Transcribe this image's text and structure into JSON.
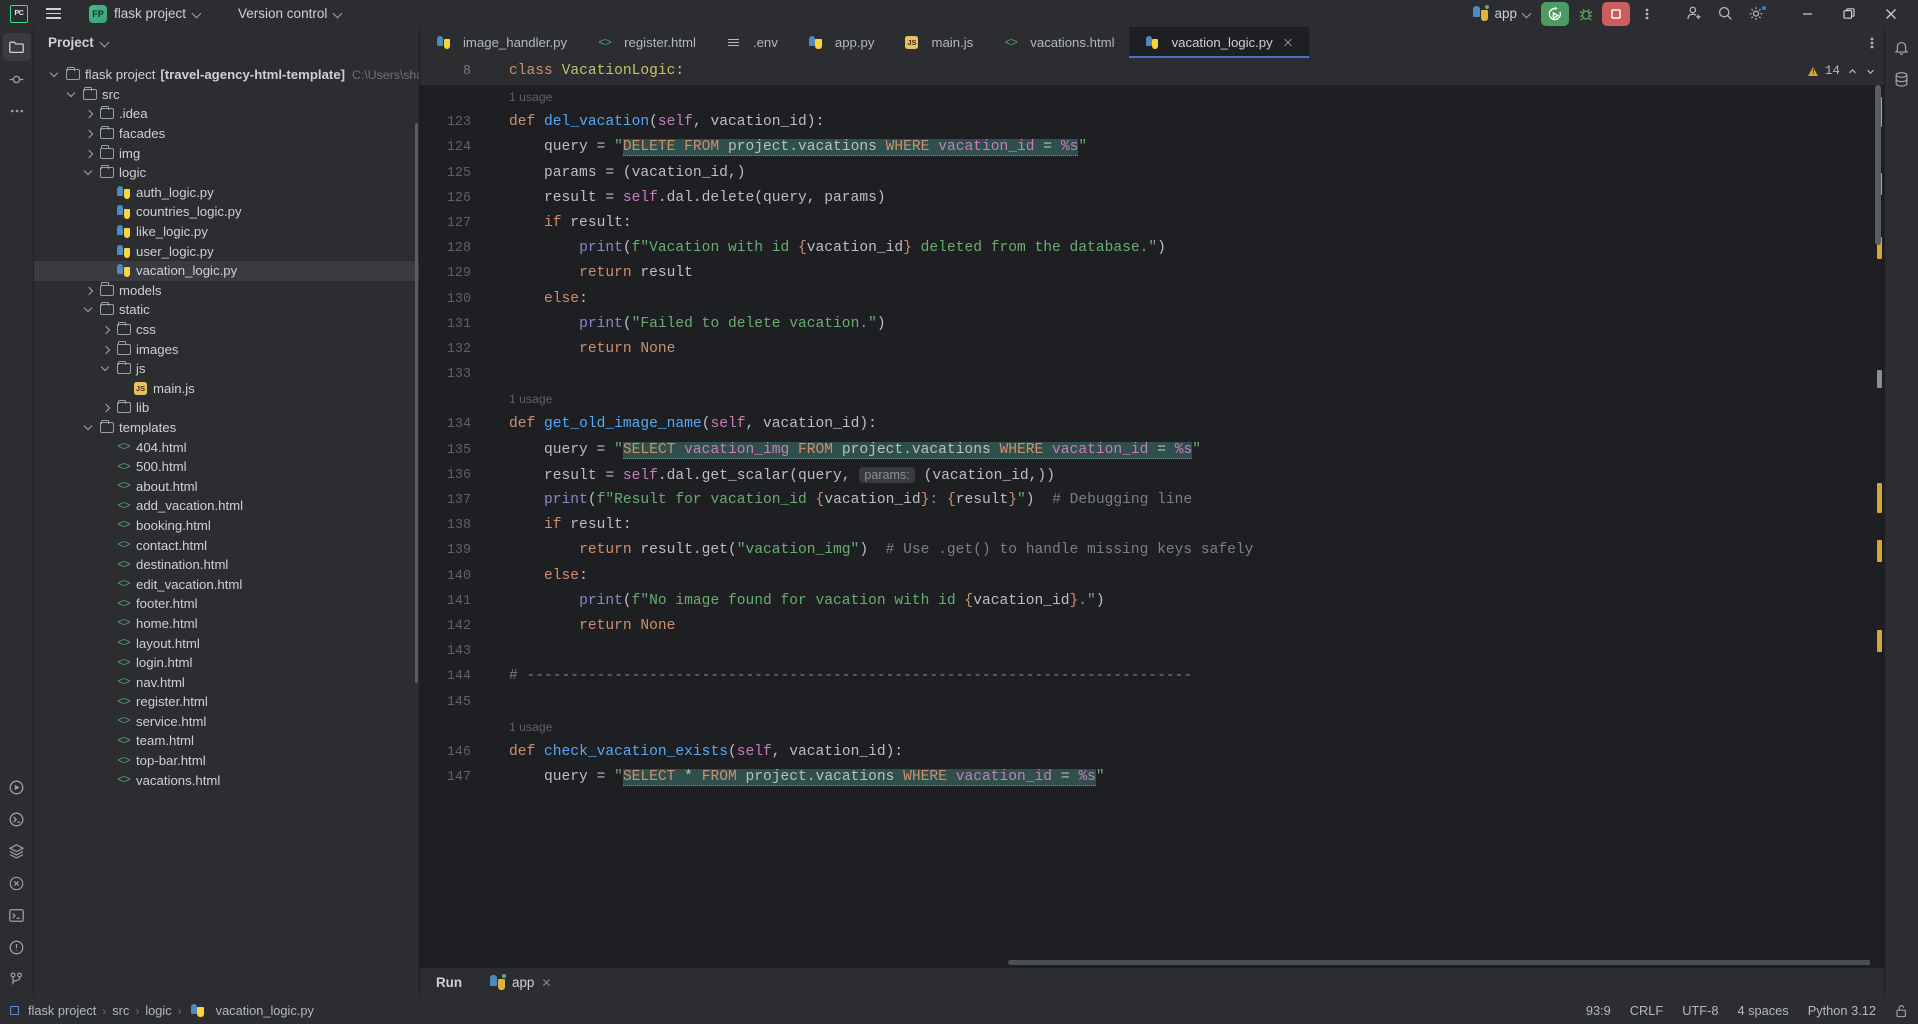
{
  "titlebar": {
    "logo": "PC",
    "menu_icon": "hamburger-icon",
    "project_badge": "FP",
    "project_name": "flask project",
    "version_control": "Version control",
    "run_config": "app",
    "icons": [
      "python-icon",
      "run-icon",
      "debug-icon",
      "stop-icon",
      "more-vertical-icon",
      "add-user-icon",
      "search-icon",
      "settings-gear-icon",
      "minimize-icon",
      "maximize-icon",
      "close-icon"
    ]
  },
  "rail": {
    "top": [
      "project-folder-icon",
      "commit-icon",
      "more-tools-icon"
    ],
    "bottom": [
      "run-icon",
      "python-console-icon",
      "services-icon",
      "debug-icon",
      "terminal-icon",
      "problems-icon",
      "branch-icon"
    ]
  },
  "right_rail": [
    "notifications-bell-icon",
    "database-icon"
  ],
  "project_panel": {
    "title": "Project",
    "tree": [
      {
        "depth": 0,
        "arrow": "down",
        "icon": "folder",
        "label": "flask project",
        "bold_suffix": "[travel-agency-html-template]",
        "path": "C:\\Users\\shani\\Deskto",
        "selected": false
      },
      {
        "depth": 1,
        "arrow": "down",
        "icon": "folder",
        "label": "src",
        "selected": false
      },
      {
        "depth": 2,
        "arrow": "right",
        "icon": "folder",
        "label": ".idea",
        "selected": false
      },
      {
        "depth": 2,
        "arrow": "right",
        "icon": "folder",
        "label": "facades",
        "selected": false
      },
      {
        "depth": 2,
        "arrow": "right",
        "icon": "folder",
        "label": "img",
        "selected": false
      },
      {
        "depth": 2,
        "arrow": "down",
        "icon": "folder",
        "label": "logic",
        "selected": false
      },
      {
        "depth": 3,
        "arrow": "none",
        "icon": "python",
        "label": "auth_logic.py",
        "selected": false
      },
      {
        "depth": 3,
        "arrow": "none",
        "icon": "python",
        "label": "countries_logic.py",
        "selected": false
      },
      {
        "depth": 3,
        "arrow": "none",
        "icon": "python",
        "label": "like_logic.py",
        "selected": false
      },
      {
        "depth": 3,
        "arrow": "none",
        "icon": "python",
        "label": "user_logic.py",
        "selected": false
      },
      {
        "depth": 3,
        "arrow": "none",
        "icon": "python",
        "label": "vacation_logic.py",
        "selected": true
      },
      {
        "depth": 2,
        "arrow": "right",
        "icon": "folder",
        "label": "models",
        "selected": false
      },
      {
        "depth": 2,
        "arrow": "down",
        "icon": "folder",
        "label": "static",
        "selected": false
      },
      {
        "depth": 3,
        "arrow": "right",
        "icon": "folder",
        "label": "css",
        "selected": false
      },
      {
        "depth": 3,
        "arrow": "right",
        "icon": "folder",
        "label": "images",
        "selected": false
      },
      {
        "depth": 3,
        "arrow": "down",
        "icon": "folder",
        "label": "js",
        "selected": false
      },
      {
        "depth": 4,
        "arrow": "none",
        "icon": "js",
        "label": "main.js",
        "selected": false
      },
      {
        "depth": 3,
        "arrow": "right",
        "icon": "folder",
        "label": "lib",
        "selected": false
      },
      {
        "depth": 2,
        "arrow": "down",
        "icon": "folder",
        "label": "templates",
        "selected": false
      },
      {
        "depth": 3,
        "arrow": "none",
        "icon": "html",
        "label": "404.html",
        "selected": false
      },
      {
        "depth": 3,
        "arrow": "none",
        "icon": "html",
        "label": "500.html",
        "selected": false
      },
      {
        "depth": 3,
        "arrow": "none",
        "icon": "html",
        "label": "about.html",
        "selected": false
      },
      {
        "depth": 3,
        "arrow": "none",
        "icon": "html",
        "label": "add_vacation.html",
        "selected": false
      },
      {
        "depth": 3,
        "arrow": "none",
        "icon": "html",
        "label": "booking.html",
        "selected": false
      },
      {
        "depth": 3,
        "arrow": "none",
        "icon": "html",
        "label": "contact.html",
        "selected": false
      },
      {
        "depth": 3,
        "arrow": "none",
        "icon": "html",
        "label": "destination.html",
        "selected": false
      },
      {
        "depth": 3,
        "arrow": "none",
        "icon": "html",
        "label": "edit_vacation.html",
        "selected": false
      },
      {
        "depth": 3,
        "arrow": "none",
        "icon": "html",
        "label": "footer.html",
        "selected": false
      },
      {
        "depth": 3,
        "arrow": "none",
        "icon": "html",
        "label": "home.html",
        "selected": false
      },
      {
        "depth": 3,
        "arrow": "none",
        "icon": "html",
        "label": "layout.html",
        "selected": false
      },
      {
        "depth": 3,
        "arrow": "none",
        "icon": "html",
        "label": "login.html",
        "selected": false
      },
      {
        "depth": 3,
        "arrow": "none",
        "icon": "html",
        "label": "nav.html",
        "selected": false
      },
      {
        "depth": 3,
        "arrow": "none",
        "icon": "html",
        "label": "register.html",
        "selected": false
      },
      {
        "depth": 3,
        "arrow": "none",
        "icon": "html",
        "label": "service.html",
        "selected": false
      },
      {
        "depth": 3,
        "arrow": "none",
        "icon": "html",
        "label": "team.html",
        "selected": false
      },
      {
        "depth": 3,
        "arrow": "none",
        "icon": "html",
        "label": "top-bar.html",
        "selected": false
      },
      {
        "depth": 3,
        "arrow": "none",
        "icon": "html",
        "label": "vacations.html",
        "selected": false
      }
    ]
  },
  "tabs": [
    {
      "label": "image_handler.py",
      "icon": "python",
      "active": false,
      "closable": false
    },
    {
      "label": "register.html",
      "icon": "html",
      "active": false,
      "closable": false
    },
    {
      "label": ".env",
      "icon": "env",
      "active": false,
      "closable": false
    },
    {
      "label": "app.py",
      "icon": "python",
      "active": false,
      "closable": false
    },
    {
      "label": "main.js",
      "icon": "js",
      "active": false,
      "closable": false
    },
    {
      "label": "vacations.html",
      "icon": "html",
      "active": false,
      "closable": false
    },
    {
      "label": "vacation_logic.py",
      "icon": "python",
      "active": true,
      "closable": true
    }
  ],
  "tabbar_more_icon": "more-vertical-icon",
  "sticky": {
    "line_number": "8",
    "code": "class VacationLogic:",
    "warning_count": "14",
    "warning_icon": "warning-triangle-icon",
    "up_icon": "chevron-up-icon",
    "down_icon": "chevron-down-icon"
  },
  "editor": {
    "filename": "vacation_logic.py",
    "lines": [
      {
        "num": "",
        "type": "usage",
        "text": "1 usage"
      },
      {
        "num": "123",
        "type": "code"
      },
      {
        "num": "124",
        "type": "code"
      },
      {
        "num": "125",
        "type": "code"
      },
      {
        "num": "126",
        "type": "code"
      },
      {
        "num": "127",
        "type": "code"
      },
      {
        "num": "128",
        "type": "code"
      },
      {
        "num": "129",
        "type": "code"
      },
      {
        "num": "130",
        "type": "code"
      },
      {
        "num": "131",
        "type": "code"
      },
      {
        "num": "132",
        "type": "code"
      },
      {
        "num": "133",
        "type": "code"
      },
      {
        "num": "",
        "type": "usage",
        "text": "1 usage"
      },
      {
        "num": "134",
        "type": "code"
      },
      {
        "num": "135",
        "type": "code"
      },
      {
        "num": "136",
        "type": "code"
      },
      {
        "num": "137",
        "type": "code"
      },
      {
        "num": "138",
        "type": "code"
      },
      {
        "num": "139",
        "type": "code"
      },
      {
        "num": "140",
        "type": "code"
      },
      {
        "num": "141",
        "type": "code"
      },
      {
        "num": "142",
        "type": "code"
      },
      {
        "num": "143",
        "type": "code"
      },
      {
        "num": "144",
        "type": "code"
      },
      {
        "num": "145",
        "type": "code"
      },
      {
        "num": "",
        "type": "usage",
        "text": "1 usage"
      },
      {
        "num": "146",
        "type": "code"
      },
      {
        "num": "147",
        "type": "code"
      }
    ],
    "source_text": [
      "1 usage",
      "def del_vacation(self, vacation_id):",
      "    query = \"DELETE FROM project.vacations WHERE vacation_id = %s\"",
      "    params = (vacation_id,)",
      "    result = self.dal.delete(query, params)",
      "    if result:",
      "        print(f\"Vacation with id {vacation_id} deleted from the database.\")",
      "        return result",
      "    else:",
      "        print(\"Failed to delete vacation.\")",
      "        return None",
      "",
      "1 usage",
      "def get_old_image_name(self, vacation_id):",
      "    query = \"SELECT vacation_img FROM project.vacations WHERE vacation_id = %s\"",
      "    result = self.dal.get_scalar(query, params: (vacation_id,))",
      "    print(f\"Result for vacation_id {vacation_id}: {result}\")  # Debugging line",
      "    if result:",
      "        return result.get(\"vacation_img\")  # Use .get() to handle missing keys safely",
      "    else:",
      "        print(f\"No image found for vacation with id {vacation_id}.\")",
      "        return None",
      "",
      "# ----------------------------------------------------------------------------",
      "",
      "1 usage",
      "def check_vacation_exists(self, vacation_id):",
      "    query = \"SELECT * FROM project.vacations WHERE vacation_id = %s\""
    ]
  },
  "run_panel": {
    "title": "Run",
    "tab_label": "app",
    "tab_icon": "python-icon",
    "close_icon": "close-icon"
  },
  "statusbar": {
    "breadcrumbs": [
      "flask project",
      "src",
      "logic",
      "vacation_logic.py"
    ],
    "breadcrumb_file_icon": "python-icon",
    "caret": "93:9",
    "line_sep": "CRLF",
    "encoding": "UTF-8",
    "indent": "4 spaces",
    "interpreter": "Python 3.12",
    "lock_icon": "unlocked-padlock-icon"
  },
  "colors": {
    "bg_editor": "#1e1f22",
    "bg_panel": "#2b2d30",
    "accent_blue": "#3574f0",
    "run_green": "#4a9c62",
    "stop_red": "#cd5c5c",
    "selection": "#393b40",
    "sql_highlight": "#2f4f4c"
  }
}
